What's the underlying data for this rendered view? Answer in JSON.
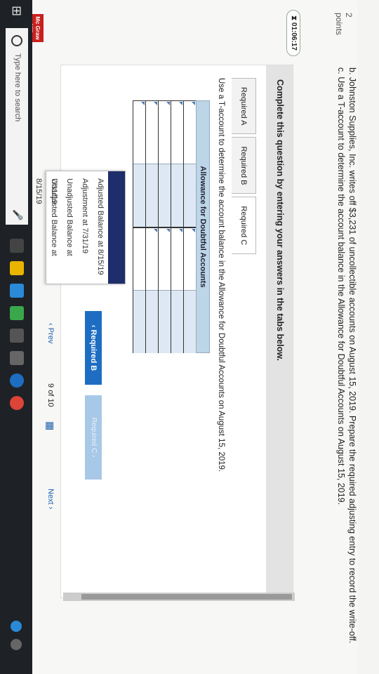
{
  "question": {
    "number": "2",
    "points_label": "points",
    "part_b": "b. Johnston Supplies, Inc. writes off $3,231 of uncollectible accounts on August 15, 2019. Prepare the required adjusting entry to record the write-off.",
    "part_c": "c. Use a T-account to determine the account balance in the Allowance for Doubtful Accounts on August 15, 2019."
  },
  "timer": "01:06:17",
  "panel": {
    "heading": "Complete this question by entering your answers in the tabs below.",
    "tabs": [
      "Required A",
      "Required B",
      "Required C"
    ],
    "instruction": "Use a T-account to determine the account balance in the Allowance for Doubtful Accounts on August 15, 2019.",
    "t_account_title": "Allowance for Doubtful Accounts",
    "dropdown_options": [
      "Adjusted Balance at 8/15/19",
      "Adjustment at 7/31/19",
      "Unadjusted Balance at 7/31/19",
      "Unadjusted Balance at 8/15/19"
    ],
    "prev_button": "‹  Required B",
    "next_button": "Required C  ›"
  },
  "pager": {
    "prev": "‹  Prev",
    "current": "9",
    "of": "of",
    "total": "10",
    "next": "Next  ›"
  },
  "logo_text": "Mc Graw Hill Education",
  "taskbar": {
    "search_placeholder": "Type here to search"
  },
  "colors": {
    "accent": "#1d6ec2",
    "dropdown_selected": "#1e2d6b",
    "t_header": "#bcd6e8",
    "logo": "#c8201e"
  }
}
